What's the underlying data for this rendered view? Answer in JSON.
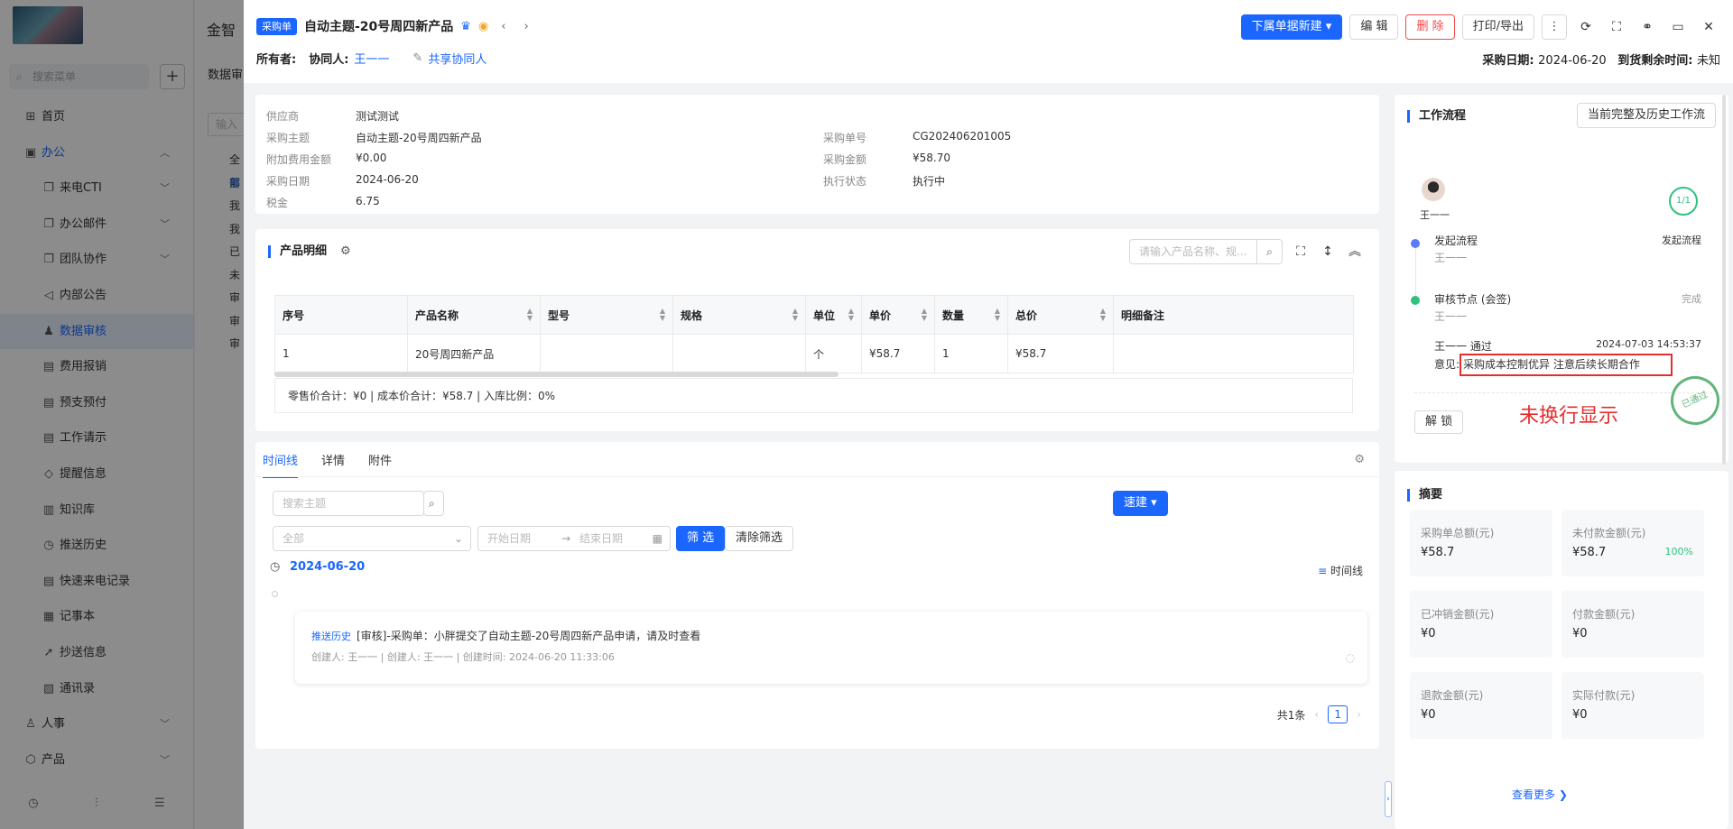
{
  "background": {
    "app_title": "金智",
    "search_placeholder": "搜索菜单",
    "nav": [
      {
        "label": "首页",
        "icon": "home-icon",
        "level": "top"
      },
      {
        "label": "办公",
        "icon": "briefcase-icon",
        "level": "top",
        "open": true
      },
      {
        "label": "来电CTI",
        "icon": "copy-icon",
        "level": "sub",
        "arrow": true
      },
      {
        "label": "办公邮件",
        "icon": "copy-icon",
        "level": "sub",
        "arrow": true
      },
      {
        "label": "团队协作",
        "icon": "copy-icon",
        "level": "sub",
        "arrow": true
      },
      {
        "label": "内部公告",
        "icon": "speaker-icon",
        "level": "sub"
      },
      {
        "label": "数据审核",
        "icon": "user-icon",
        "level": "sub",
        "active": true
      },
      {
        "label": "费用报销",
        "icon": "doc-icon",
        "level": "sub"
      },
      {
        "label": "预支预付",
        "icon": "doc-icon",
        "level": "sub"
      },
      {
        "label": "工作请示",
        "icon": "doc-icon",
        "level": "sub"
      },
      {
        "label": "提醒信息",
        "icon": "bell-icon",
        "level": "sub"
      },
      {
        "label": "知识库",
        "icon": "book-icon",
        "level": "sub"
      },
      {
        "label": "推送历史",
        "icon": "clock-icon",
        "level": "sub"
      },
      {
        "label": "快速来电记录",
        "icon": "doc-icon",
        "level": "sub"
      },
      {
        "label": "记事本",
        "icon": "note-icon",
        "level": "sub"
      },
      {
        "label": "抄送信息",
        "icon": "send-icon",
        "level": "sub"
      },
      {
        "label": "通讯录",
        "icon": "contacts-icon",
        "level": "sub"
      },
      {
        "label": "人事",
        "icon": "people-icon",
        "level": "top",
        "arrow": true
      },
      {
        "label": "产品",
        "icon": "box-icon",
        "level": "top",
        "arrow": true
      }
    ],
    "col2_title": "数据审",
    "col2_input": "输入",
    "tree": [
      "全部",
      "需",
      "我",
      "我",
      "已",
      "未",
      "审",
      "审",
      "审"
    ]
  },
  "header": {
    "tag": "采购单",
    "title": "自动主题-20号周四新产品",
    "owner_label": "所有者:",
    "collab_label": "协同人:",
    "collab_value": "王一一",
    "share_label": "共享协同人",
    "btn_new_sub": "下属单据新建",
    "btn_edit": "编 辑",
    "btn_delete": "删 除",
    "btn_print": "打印/导出",
    "purchase_date_label": "采购日期:",
    "purchase_date_value": "2024-06-20",
    "remaining_label": "到货剩余时间:",
    "remaining_value": "未知"
  },
  "info": {
    "supplier_label": "供应商",
    "supplier_value": "测试测试",
    "subject_label": "采购主题",
    "subject_value": "自动主题-20号周四新产品",
    "extra_fee_label": "附加费用金额",
    "extra_fee_value": "¥0.00",
    "date_label": "采购日期",
    "date_value": "2024-06-20",
    "tax_label": "税金",
    "tax_value": "6.75",
    "order_no_label": "采购单号",
    "order_no_value": "CG202406201005",
    "amount_label": "采购金额",
    "amount_value": "¥58.70",
    "status_label": "执行状态",
    "status_value": "执行中"
  },
  "products": {
    "title": "产品明细",
    "search_placeholder": "请输入产品名称、规...",
    "columns": [
      "序号",
      "产品名称",
      "型号",
      "规格",
      "单位",
      "单价",
      "数量",
      "总价",
      "明细备注"
    ],
    "rows": [
      [
        "1",
        "20号周四新产品",
        "",
        "",
        "个",
        "¥58.7",
        "1",
        "¥58.7",
        ""
      ]
    ],
    "summary": "零售价合计：¥0 |   成本价合计：¥58.7 |   入库比例：0%"
  },
  "timeline": {
    "tabs": [
      "时间线",
      "详情",
      "附件"
    ],
    "search_placeholder": "搜索主题",
    "quick_new": "速建",
    "all_placeholder": "全部",
    "start_placeholder": "开始日期",
    "end_placeholder": "结束日期",
    "filter_btn": "筛 选",
    "clear_btn": "清除筛选",
    "date": "2024-06-20",
    "view_label": "时间线",
    "event_tag": "推送历史",
    "event_text": "[审核]-采购单：小胖提交了自动主题-20号周四新产品申请，请及时查看",
    "event_meta": "创建人: 王一一   |   创建人: 王一一   |   创建时间: 2024-06-20 11:33:06",
    "total": "共1条",
    "page": "1"
  },
  "workflow": {
    "title": "工作流程",
    "history_btn": "当前完整及历史工作流",
    "user": "王一一",
    "progress": "1/1",
    "step1_name": "发起流程",
    "step1_user": "王一一",
    "step1_status": "发起流程",
    "step2_name": "审核节点 (会签)",
    "step2_user": "王一一",
    "step2_status": "完成",
    "approval_line": "王一一 通过",
    "approval_time": "2024-07-03 14:53:37",
    "opinion_label": "意见:",
    "opinion_text": "采购成本控制优异 注意后续长期合作",
    "unlock_btn": "解 锁",
    "annotation": "未换行显示",
    "stamp_text": "已通过"
  },
  "summary": {
    "title": "摘要",
    "items": [
      {
        "label": "采购单总额(元)",
        "value": "¥58.7"
      },
      {
        "label": "未付款金额(元)",
        "value": "¥58.7",
        "pct": "100%"
      },
      {
        "label": "已冲销金额(元)",
        "value": "¥0"
      },
      {
        "label": "付款金额(元)",
        "value": "¥0"
      },
      {
        "label": "退款金额(元)",
        "value": "¥0"
      },
      {
        "label": "实际付款(元)",
        "value": "¥0"
      }
    ],
    "more": "查看更多"
  },
  "colors": {
    "accent": "#1a66ff",
    "danger": "#f04a4a",
    "success": "#2ec27e",
    "status": "#f5a623"
  }
}
